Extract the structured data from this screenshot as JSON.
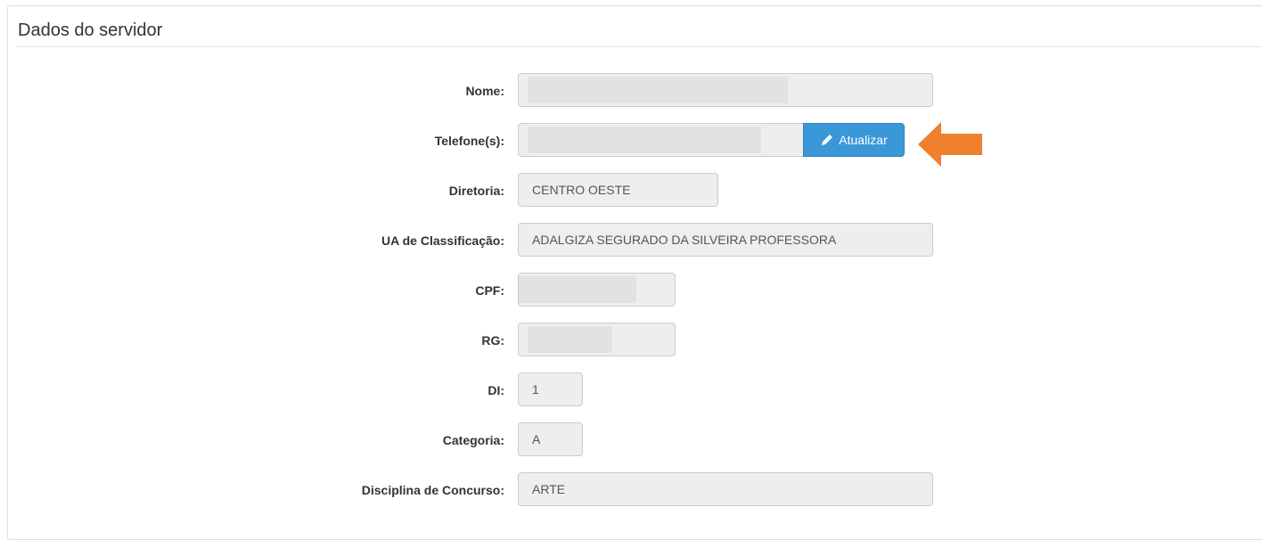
{
  "panel": {
    "title": "Dados do servidor"
  },
  "fields": {
    "nome": {
      "label": "Nome:",
      "value": ""
    },
    "telefone": {
      "label": "Telefone(s):",
      "value": "",
      "button_label": "Atualizar"
    },
    "diretoria": {
      "label": "Diretoria:",
      "value": "CENTRO OESTE"
    },
    "ua": {
      "label": "UA de Classificação:",
      "value": "ADALGIZA SEGURADO DA SILVEIRA PROFESSORA"
    },
    "cpf": {
      "label": "CPF:",
      "value": ""
    },
    "rg": {
      "label": "RG:",
      "value": ""
    },
    "di": {
      "label": "DI:",
      "value": "1"
    },
    "categoria": {
      "label": "Categoria:",
      "value": "A"
    },
    "disciplina": {
      "label": "Disciplina de Concurso:",
      "value": "ARTE"
    }
  },
  "icons": {
    "button_icon": "pencil-icon",
    "annotation": "orange-arrow-left"
  },
  "colors": {
    "button": "#3a98d8",
    "arrow": "#f07f2e",
    "field_bg": "#eeeeee"
  }
}
